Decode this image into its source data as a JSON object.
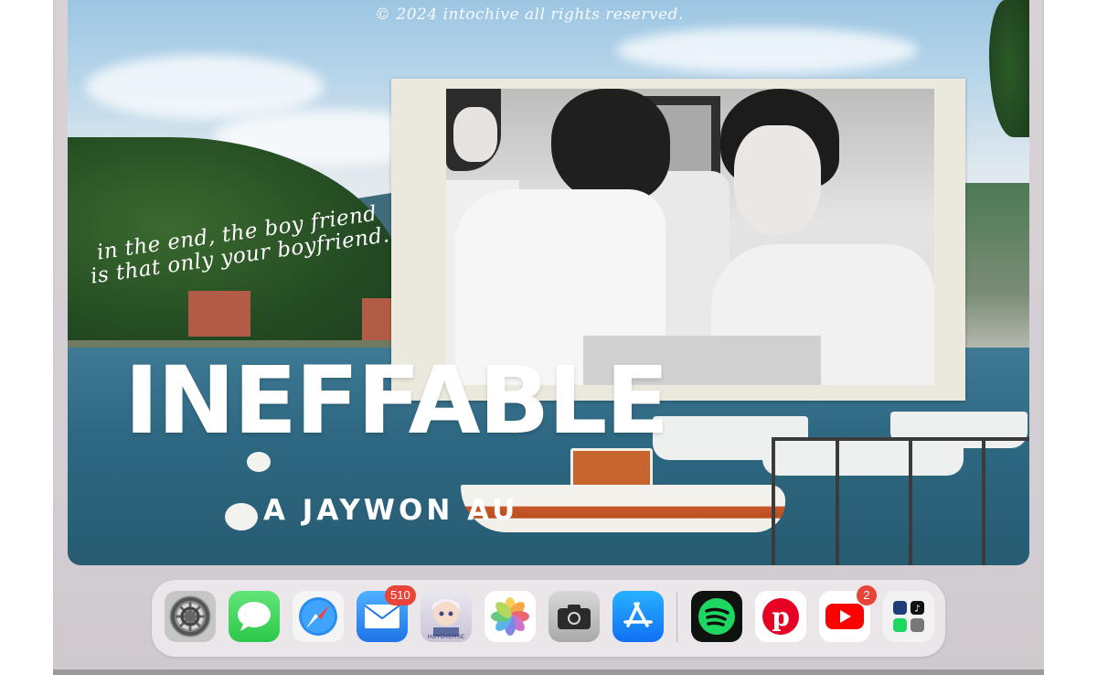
{
  "wallpaper": {
    "copyright": "© 2024 intochive all rights reserved.",
    "quote": "in the end, the boy friend is that only your boyfriend.",
    "title": "INEFFABLE",
    "subtitle": "A JAYWON AU"
  },
  "dock": {
    "apps": [
      {
        "name": "Settings",
        "icon": "gear-icon"
      },
      {
        "name": "Messages",
        "icon": "speech-bubble-icon"
      },
      {
        "name": "Safari",
        "icon": "compass-icon"
      },
      {
        "name": "Mail",
        "icon": "envelope-icon",
        "badge": "510"
      },
      {
        "name": "Genshin Impact",
        "icon": "game-character-icon",
        "label": "HOYOVERSE"
      },
      {
        "name": "Photos",
        "icon": "flower-icon"
      },
      {
        "name": "Camera",
        "icon": "camera-icon"
      },
      {
        "name": "App Store",
        "icon": "app-store-icon"
      },
      {
        "name": "Spotify",
        "icon": "spotify-icon"
      },
      {
        "name": "Pinterest",
        "icon": "pinterest-icon"
      },
      {
        "name": "YouTube",
        "icon": "play-icon",
        "badge": "2"
      },
      {
        "name": "App Folder",
        "icon": "folder-icon"
      }
    ]
  },
  "colors": {
    "badge": "#ea4338",
    "dock_bg": "#ece8eb",
    "device": "#d4cfd3"
  }
}
